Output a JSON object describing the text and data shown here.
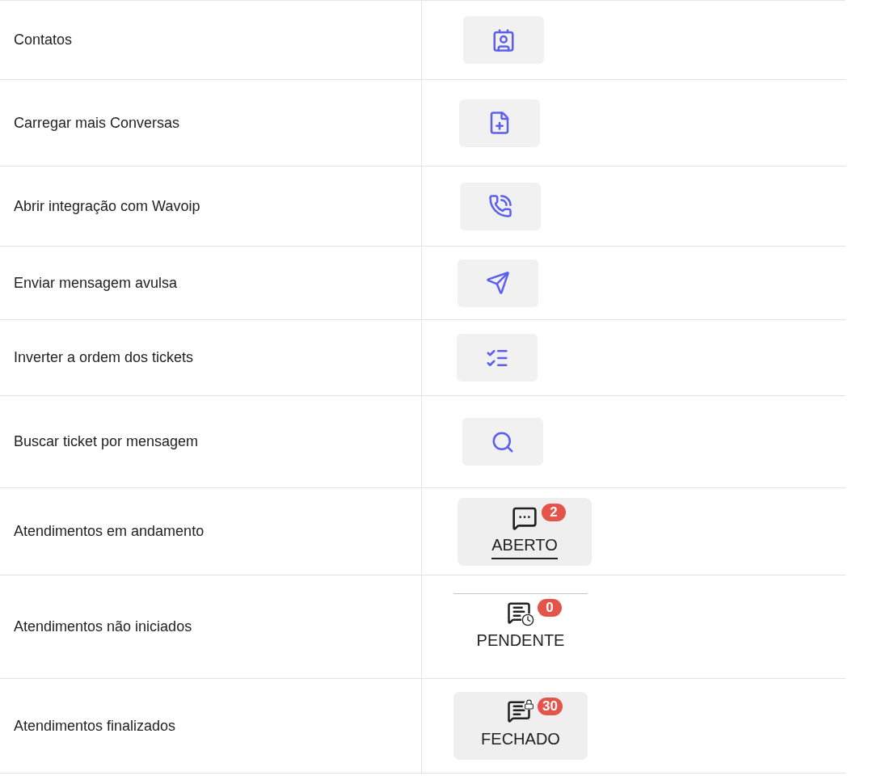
{
  "rows": [
    {
      "description": "Contatos",
      "control": {
        "kind": "icon_button"
      }
    },
    {
      "description": "Carregar mais Conversas",
      "control": {
        "kind": "icon_button"
      }
    },
    {
      "description": "Abrir integração com Wavoip",
      "control": {
        "kind": "icon_button"
      }
    },
    {
      "description": "Enviar mensagem avulsa",
      "control": {
        "kind": "icon_button"
      }
    },
    {
      "description": "Inverter a ordem dos tickets",
      "control": {
        "kind": "icon_button"
      }
    },
    {
      "description": "Buscar ticket por mensagem",
      "control": {
        "kind": "icon_button"
      }
    },
    {
      "description": "Atendimentos em andamento",
      "control": {
        "kind": "tab",
        "label": "ABERTO",
        "badge": "2",
        "selected": true,
        "shaded": true
      }
    },
    {
      "description": "Atendimentos não iniciados",
      "control": {
        "kind": "tab",
        "label": "PENDENTE",
        "badge": "0",
        "selected": false,
        "shaded": false
      }
    },
    {
      "description": "Atendimentos finalizados",
      "control": {
        "kind": "tab",
        "label": "FECHADO",
        "badge": "30",
        "selected": false,
        "shaded": true
      }
    }
  ]
}
